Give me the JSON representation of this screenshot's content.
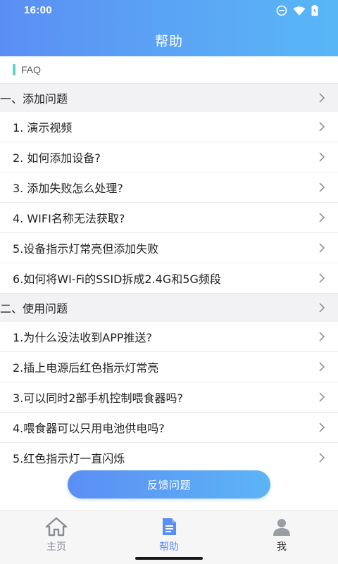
{
  "status_bar": {
    "time": "16:00"
  },
  "header": {
    "title": "帮助"
  },
  "faq_label": "FAQ",
  "sections": [
    {
      "title": "一、添加问题",
      "items": [
        "1. 演示视频",
        "2. 如何添加设备?",
        "3. 添加失败怎么处理?",
        "4. WIFI名称无法获取?",
        "5.设备指示灯常亮但添加失败",
        "6.如何将WI-Fi的SSID拆成2.4G和5G频段"
      ]
    },
    {
      "title": "二、使用问题",
      "items": [
        "1.为什么没法收到APP推送?",
        "2.插上电源后红色指示灯常亮",
        "3.可以同时2部手机控制喂食器吗?",
        "4.喂食器可以只用电池供电吗?",
        "5.红色指示灯一直闪烁"
      ]
    }
  ],
  "feedback_button": "反馈问题",
  "tabs": [
    {
      "label": "主页",
      "icon": "home-icon"
    },
    {
      "label": "帮助",
      "icon": "document-icon",
      "active": true
    },
    {
      "label": "我",
      "icon": "person-icon"
    }
  ],
  "colors": {
    "accent": "#5b8ef4",
    "faq_marker": "#62d2c5",
    "section_bg": "#f2f2f4"
  }
}
